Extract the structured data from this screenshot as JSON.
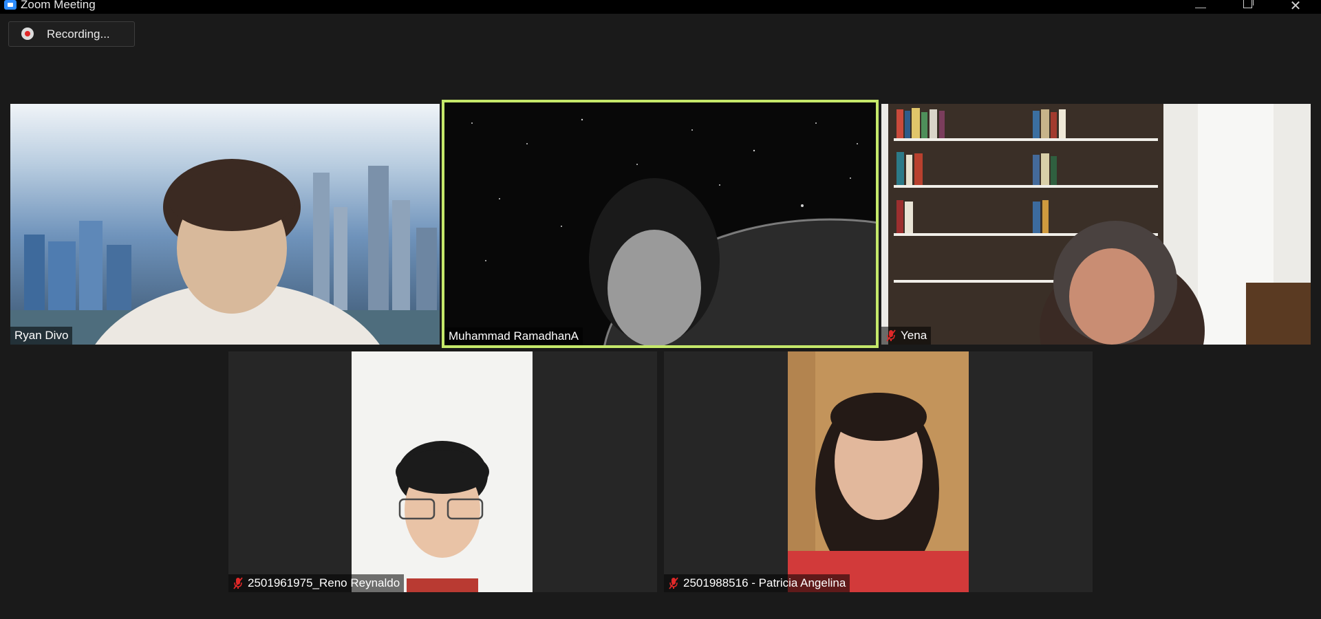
{
  "window": {
    "title": "Zoom Meeting"
  },
  "recording": {
    "label": "Recording..."
  },
  "participants": [
    {
      "name": "Ryan Divo",
      "muted": false,
      "active_speaker": false
    },
    {
      "name": "Muhammad RamadhanA",
      "muted": false,
      "active_speaker": true
    },
    {
      "name": "Yena",
      "muted": true,
      "active_speaker": false
    },
    {
      "name": "2501961975_Reno Reynaldo",
      "muted": true,
      "active_speaker": false
    },
    {
      "name": "2501988516 - Patricia Angelina",
      "muted": true,
      "active_speaker": false
    }
  ],
  "colors": {
    "active_speaker_border": "#c5e86a",
    "recording_dot": "#e02828",
    "muted_icon": "#e02828",
    "background": "#1a1a1a"
  }
}
